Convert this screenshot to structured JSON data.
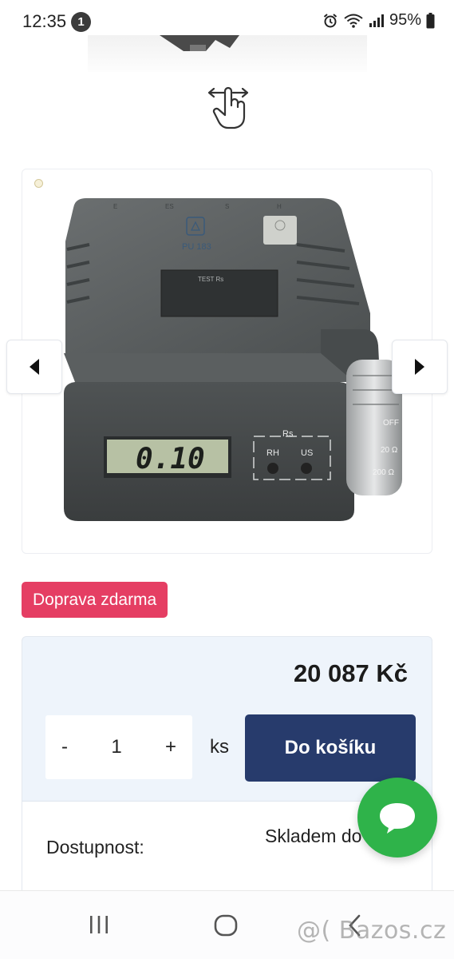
{
  "status_bar": {
    "time": "12:35",
    "notification_count": "1",
    "battery": "95%",
    "icons": [
      "alarm-icon",
      "wifi-icon",
      "signal-icon",
      "battery-icon"
    ]
  },
  "gallery": {
    "prev_icon": "chevron-left-icon",
    "next_icon": "chevron-right-icon",
    "swipe_icon": "swipe-hand-icon",
    "device": {
      "model_label": "PU 183",
      "panel_label": "TEST Rs",
      "display_value": "0.10",
      "switch_labels": [
        "Rs",
        "RH",
        "US"
      ],
      "dial_labels": [
        "OFF",
        "20 Ω",
        "200 Ω"
      ],
      "top_letters": [
        "E",
        "ES",
        "S",
        "H"
      ]
    }
  },
  "badge": {
    "label": "Doprava zdarma",
    "color": "#e53e63"
  },
  "purchase": {
    "price": "20 087 Kč",
    "qty_minus": "-",
    "qty_value": "1",
    "qty_plus": "+",
    "unit": "ks",
    "add_to_cart_label": "Do košíku",
    "button_color": "#273b6c"
  },
  "availability": {
    "label": "Dostupnost:",
    "value": "Skladem do 7 dní"
  },
  "chat": {
    "icon": "chat-bubble-icon",
    "color": "#2fb34a"
  },
  "bottom_nav": {
    "items": [
      "recent-apps-icon",
      "home-icon",
      "back-icon"
    ]
  },
  "watermark": "@( Bazos.cz"
}
